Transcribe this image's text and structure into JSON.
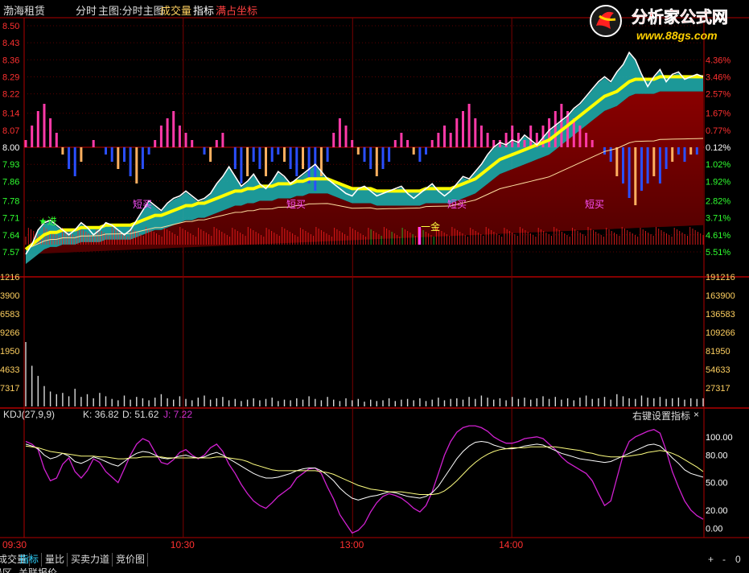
{
  "header": {
    "stock_name": "渤海租赁",
    "mode": "分时",
    "main_chart": "主图:分时主图",
    "volume_label": "成交量",
    "indicator_label": "指标",
    "full_axis_label": "满占坐标"
  },
  "logo": {
    "title": "分析家公式网",
    "url": "www.88gs.com"
  },
  "kdj": {
    "name": "KDJ(27,9,9)",
    "k_text": "K: 36.82",
    "d_text": "D: 51.62",
    "j_text": "J: 7.22",
    "settings_text": "右键设置指标",
    "close_icon": "×"
  },
  "tabs": [
    "成交量",
    "指标",
    "量比",
    "买卖力道",
    "竞价图"
  ],
  "tab_controls": [
    "+",
    "-",
    "0"
  ],
  "footer_partial": [
    "景区",
    "关联报价"
  ],
  "colors": {
    "price_line": "#ffffff",
    "avg_line": "#ffff00",
    "cyan_band": "#1fa8a8",
    "dark_red_band": "#7a0000",
    "up_bar": "#ff3aa8",
    "down_bar": "#2a4fff",
    "orange_bar": "#ffb060",
    "kdj_k": "#ffffff",
    "kdj_d": "#ffff80",
    "kdj_j": "#d020d0"
  },
  "chart_data": [
    {
      "type": "line",
      "name": "price",
      "x_ticks": [
        "09:30",
        "10:30",
        "13:00",
        "14:00"
      ],
      "y_left_ticks": [
        "8.50",
        "8.43",
        "8.36",
        "8.29",
        "8.22",
        "8.14",
        "8.07",
        "8.00",
        "7.93",
        "7.86",
        "7.78",
        "7.71",
        "7.64",
        "7.57"
      ],
      "y_right_ticks": [
        "4.36%",
        "3.46%",
        "2.57%",
        "1.67%",
        "0.77%",
        "0.12%",
        "1.02%",
        "1.92%",
        "2.82%",
        "3.71%",
        "4.61%",
        "5.51%"
      ],
      "ylim": [
        7.54,
        8.5
      ],
      "baseline": 8.0,
      "price": [
        7.56,
        7.6,
        7.66,
        7.69,
        7.7,
        7.68,
        7.66,
        7.64,
        7.66,
        7.69,
        7.67,
        7.64,
        7.66,
        7.69,
        7.68,
        7.66,
        7.64,
        7.66,
        7.7,
        7.74,
        7.78,
        7.76,
        7.74,
        7.77,
        7.79,
        7.8,
        7.82,
        7.8,
        7.78,
        7.79,
        7.81,
        7.85,
        7.88,
        7.92,
        7.88,
        7.84,
        7.86,
        7.89,
        7.85,
        7.83,
        7.86,
        7.9,
        7.88,
        7.85,
        7.87,
        7.89,
        7.91,
        7.93,
        7.9,
        7.87,
        7.85,
        7.83,
        7.81,
        7.8,
        7.83,
        7.84,
        7.82,
        7.8,
        7.81,
        7.82,
        7.83,
        7.84,
        7.81,
        7.79,
        7.81,
        7.83,
        7.85,
        7.82,
        7.8,
        7.82,
        7.85,
        7.88,
        7.87,
        7.9,
        7.93,
        7.97,
        8.0,
        8.02,
        8.01,
        8.03,
        8.02,
        8.05,
        8.03,
        8.01,
        8.04,
        8.07,
        8.09,
        8.11,
        8.13,
        8.16,
        8.18,
        8.21,
        8.24,
        8.27,
        8.29,
        8.27,
        8.31,
        8.34,
        8.39,
        8.36,
        8.3,
        8.25,
        8.29,
        8.32,
        8.27,
        8.3,
        8.31,
        8.28,
        8.29,
        8.3,
        8.29
      ],
      "avg": [
        7.58,
        7.6,
        7.62,
        7.64,
        7.65,
        7.65,
        7.66,
        7.66,
        7.66,
        7.67,
        7.67,
        7.67,
        7.67,
        7.68,
        7.68,
        7.68,
        7.68,
        7.68,
        7.69,
        7.7,
        7.71,
        7.72,
        7.72,
        7.73,
        7.74,
        7.75,
        7.76,
        7.76,
        7.77,
        7.77,
        7.78,
        7.79,
        7.8,
        7.81,
        7.82,
        7.82,
        7.83,
        7.83,
        7.84,
        7.84,
        7.84,
        7.85,
        7.85,
        7.85,
        7.86,
        7.86,
        7.87,
        7.87,
        7.87,
        7.87,
        7.86,
        7.85,
        7.84,
        7.83,
        7.83,
        7.83,
        7.83,
        7.82,
        7.82,
        7.82,
        7.82,
        7.82,
        7.82,
        7.82,
        7.82,
        7.83,
        7.83,
        7.83,
        7.83,
        7.83,
        7.84,
        7.85,
        7.86,
        7.87,
        7.89,
        7.91,
        7.93,
        7.95,
        7.96,
        7.97,
        7.98,
        7.99,
        8.0,
        8.01,
        8.02,
        8.03,
        8.05,
        8.07,
        8.09,
        8.11,
        8.13,
        8.15,
        8.17,
        8.19,
        8.21,
        8.22,
        8.23,
        8.25,
        8.27,
        8.28,
        8.28,
        8.28,
        8.28,
        8.29,
        8.29,
        8.29,
        8.29,
        8.29,
        8.29,
        8.29,
        8.29
      ],
      "macd": [
        1,
        3,
        5,
        6,
        4,
        2,
        -1,
        -3,
        -4,
        -2,
        0,
        1,
        0,
        -1,
        -2,
        -3,
        -2,
        -4,
        -5,
        -3,
        -1,
        1,
        3,
        4,
        5,
        3,
        2,
        1,
        0,
        -1,
        -2,
        1,
        2,
        0,
        -3,
        -5,
        -4,
        -2,
        -3,
        -4,
        -2,
        -1,
        -2,
        -3,
        -4,
        -3,
        -5,
        -6,
        -4,
        -2,
        2,
        4,
        3,
        1,
        -1,
        -2,
        -3,
        -4,
        -3,
        -2,
        1,
        2,
        1,
        -1,
        -2,
        -1,
        1,
        2,
        3,
        2,
        4,
        5,
        6,
        4,
        3,
        2,
        1,
        1,
        2,
        3,
        2,
        1,
        3,
        2,
        3,
        4,
        5,
        6,
        5,
        4,
        3,
        2,
        1,
        0,
        -1,
        -2,
        -4,
        -5,
        -7,
        -8,
        -6,
        -5,
        -4,
        -5,
        -3,
        -2,
        -1,
        -2,
        -1,
        -1,
        0
      ],
      "annotations": [
        "★进",
        "短买",
        "短买",
        "短买",
        "短买",
        "一金"
      ]
    },
    {
      "type": "bar",
      "name": "volume",
      "y_left_ticks": [
        "1216",
        "3900",
        "6583",
        "9266",
        "1950",
        "4633",
        "7317"
      ],
      "y_right_ticks": [
        "191216",
        "163900",
        "136583",
        "109266",
        "81950",
        "54633",
        "27317"
      ],
      "ylim": [
        0,
        191216
      ],
      "values": [
        95000,
        60000,
        45000,
        30000,
        22000,
        18000,
        20000,
        15000,
        26000,
        14000,
        18000,
        12000,
        20000,
        15000,
        11000,
        9000,
        16000,
        10000,
        14000,
        12000,
        9000,
        13000,
        18000,
        12000,
        10000,
        15000,
        11000,
        9000,
        13000,
        16000,
        10000,
        12000,
        14000,
        9000,
        11000,
        8000,
        10000,
        12000,
        9000,
        11000,
        13000,
        8000,
        10000,
        9000,
        12000,
        10000,
        15000,
        11000,
        9000,
        14000,
        10000,
        8000,
        12000,
        9000,
        11000,
        7000,
        10000,
        8000,
        9000,
        12000,
        8000,
        10000,
        11000,
        9000,
        12000,
        8000,
        10000,
        13000,
        9000,
        11000,
        12000,
        10000,
        14000,
        11000,
        16000,
        13000,
        10000,
        12000,
        9000,
        14000,
        11000,
        13000,
        10000,
        12000,
        15000,
        11000,
        14000,
        10000,
        12000,
        9000,
        13000,
        16000,
        11000,
        12000,
        14000,
        10000,
        18000,
        15000,
        12000,
        11000,
        16000,
        13000,
        12000,
        14000,
        11000,
        12000,
        13000,
        10000,
        12000,
        11000,
        12000
      ]
    },
    {
      "type": "line",
      "name": "KDJ",
      "y_right_ticks": [
        "100.00",
        "80.00",
        "50.00",
        "20.00",
        "0.00"
      ],
      "ylim": [
        -10,
        120
      ],
      "K": [
        92,
        90,
        87,
        80,
        76,
        78,
        82,
        79,
        73,
        71,
        74,
        78,
        76,
        73,
        70,
        68,
        73,
        78,
        82,
        84,
        83,
        80,
        77,
        76,
        77,
        79,
        80,
        78,
        77,
        78,
        81,
        83,
        80,
        76,
        72,
        68,
        64,
        60,
        57,
        55,
        55,
        56,
        58,
        60,
        63,
        65,
        66,
        66,
        63,
        58,
        52,
        44,
        38,
        33,
        31,
        33,
        35,
        36,
        38,
        40,
        39,
        37,
        35,
        34,
        33,
        35,
        39,
        46,
        56,
        66,
        76,
        84,
        90,
        94,
        95,
        94,
        91,
        89,
        87,
        87,
        88,
        90,
        91,
        92,
        91,
        88,
        85,
        82,
        80,
        78,
        76,
        75,
        74,
        73,
        72,
        73,
        76,
        79,
        82,
        85,
        88,
        91,
        92,
        90,
        84,
        77,
        71,
        64,
        60,
        58,
        56
      ],
      "D": [
        90,
        89,
        88,
        86,
        84,
        83,
        82,
        81,
        80,
        79,
        79,
        79,
        78,
        78,
        77,
        76,
        76,
        77,
        77,
        78,
        78,
        78,
        78,
        77,
        77,
        77,
        77,
        77,
        77,
        77,
        77,
        78,
        78,
        77,
        76,
        75,
        73,
        70,
        68,
        66,
        64,
        63,
        63,
        63,
        63,
        63,
        63,
        63,
        62,
        61,
        59,
        56,
        53,
        50,
        47,
        45,
        43,
        42,
        41,
        40,
        40,
        40,
        39,
        38,
        37,
        37,
        37,
        38,
        41,
        46,
        52,
        59,
        66,
        72,
        77,
        81,
        84,
        86,
        87,
        88,
        88,
        88,
        89,
        89,
        89,
        89,
        89,
        88,
        87,
        86,
        85,
        83,
        82,
        80,
        79,
        78,
        78,
        78,
        79,
        80,
        81,
        83,
        84,
        85,
        84,
        82,
        79,
        75,
        71,
        67,
        62
      ],
      "J": [
        95,
        92,
        86,
        65,
        52,
        55,
        70,
        77,
        62,
        55,
        63,
        76,
        72,
        62,
        56,
        50,
        65,
        80,
        92,
        98,
        95,
        83,
        72,
        70,
        75,
        83,
        86,
        80,
        76,
        80,
        88,
        92,
        84,
        70,
        60,
        48,
        38,
        30,
        25,
        22,
        28,
        35,
        40,
        45,
        55,
        60,
        65,
        66,
        60,
        45,
        32,
        15,
        5,
        -5,
        -2,
        5,
        18,
        28,
        35,
        38,
        36,
        33,
        28,
        22,
        18,
        25,
        40,
        60,
        80,
        95,
        105,
        110,
        112,
        112,
        110,
        106,
        100,
        96,
        93,
        93,
        95,
        98,
        99,
        100,
        98,
        92,
        86,
        78,
        72,
        68,
        64,
        60,
        52,
        38,
        25,
        30,
        55,
        80,
        95,
        100,
        103,
        106,
        108,
        104,
        85,
        62,
        45,
        30,
        20,
        14,
        10
      ]
    }
  ]
}
